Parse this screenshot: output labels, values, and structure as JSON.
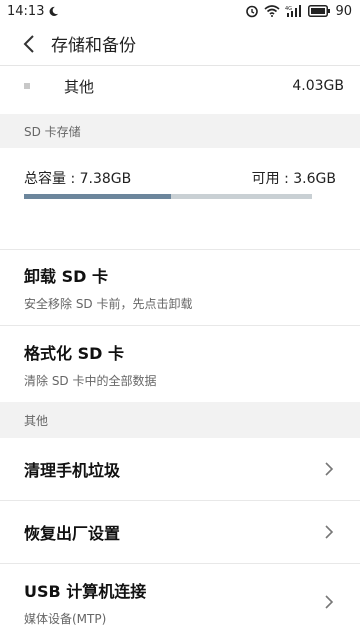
{
  "status": {
    "time": "14:13",
    "battery": "90"
  },
  "header": {
    "title": "存储和备份"
  },
  "other_row": {
    "label": "其他",
    "value": "4.03GB"
  },
  "sd_section": {
    "label": "SD 卡存储"
  },
  "sd": {
    "total": "总容量 : 7.38GB",
    "available": "可用 : 3.6GB",
    "used_fraction": 0.51
  },
  "unmount": {
    "title": "卸载 SD 卡",
    "subtitle": "安全移除 SD 卡前，先点击卸载"
  },
  "format": {
    "title": "格式化 SD 卡",
    "subtitle": "清除 SD 卡中的全部数据"
  },
  "other_section": {
    "label": "其他"
  },
  "clean": {
    "title": "清理手机垃圾"
  },
  "reset": {
    "title": "恢复出厂设置"
  },
  "usb": {
    "title": "USB 计算机连接",
    "subtitle": "媒体设备(MTP)"
  }
}
